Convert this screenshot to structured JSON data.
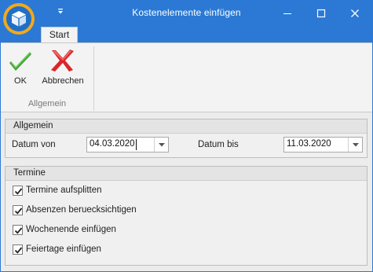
{
  "window": {
    "title": "Kostenelemente einfügen"
  },
  "ribbon": {
    "tabs": [
      {
        "label": "Start"
      }
    ],
    "buttons": {
      "ok_label": "OK",
      "cancel_label": "Abbrechen"
    },
    "group_label": "Allgemein"
  },
  "allgemein": {
    "header": "Allgemein",
    "datum_von_label": "Datum von",
    "datum_von_value": "04.03.2020",
    "datum_bis_label": "Datum bis",
    "datum_bis_value": "11.03.2020"
  },
  "termine": {
    "header": "Termine",
    "options": [
      {
        "label": "Termine aufsplitten",
        "checked": true
      },
      {
        "label": "Absenzen beruecksichtigen",
        "checked": true
      },
      {
        "label": "Wochenende einfügen",
        "checked": true
      },
      {
        "label": "Feiertage einfügen",
        "checked": true
      }
    ]
  },
  "colors": {
    "titlebar": "#2b79d4",
    "app_icon_ring": "#f2a81d",
    "ok_green": "#3ea531",
    "cancel_red": "#d9262a"
  },
  "icons": {
    "app": "cube-icon",
    "quick_access": "quick-access-dropdown-icon",
    "minimize": "minimize-icon",
    "maximize": "maximize-icon",
    "close": "close-icon",
    "ok": "checkmark-icon",
    "cancel": "red-x-icon",
    "dropdown": "chevron-down-icon",
    "checkbox": "checkmark-icon"
  }
}
